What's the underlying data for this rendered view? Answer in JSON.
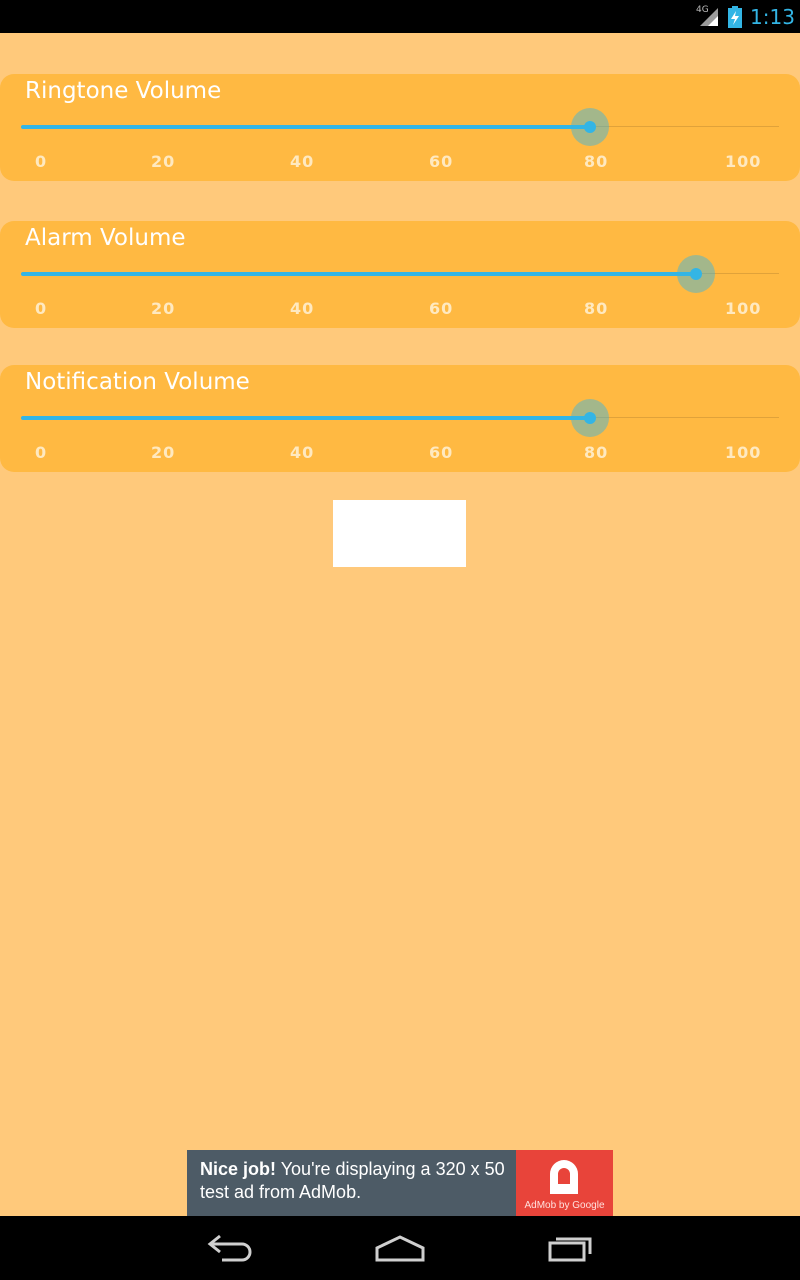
{
  "status_bar": {
    "network_label": "4G",
    "clock": "1:13",
    "icons": [
      "signal-icon",
      "battery-charging-icon"
    ],
    "accent_color": "#33b5e5"
  },
  "volumes": [
    {
      "label": "Ringtone Volume",
      "value": 75
    },
    {
      "label": "Alarm Volume",
      "value": 89
    },
    {
      "label": "Notification Volume",
      "value": 75
    }
  ],
  "scale": [
    "0",
    "20",
    "40",
    "60",
    "80",
    "100"
  ],
  "ad": {
    "headline": "Nice job!",
    "body": " You're displaying a 320 x 50 test ad from AdMob.",
    "logo_text": "AdMob by Google"
  },
  "nav_bar": {
    "buttons": [
      "back-icon",
      "home-icon",
      "recents-icon"
    ]
  },
  "colors": {
    "background": "#ffc97b",
    "card": "#ffb942",
    "slider": "#33b5e5"
  }
}
